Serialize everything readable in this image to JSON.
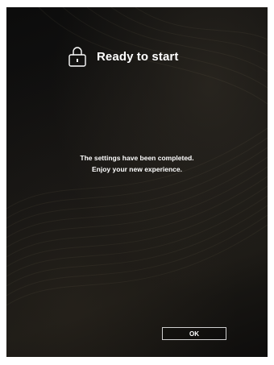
{
  "header": {
    "icon": "lock-icon",
    "title": "Ready to start"
  },
  "message": {
    "line1": "The settings have been completed.",
    "line2": "Enjoy your new experience."
  },
  "actions": {
    "ok_label": "OK"
  },
  "colors": {
    "background": "#121110",
    "text": "#ffffff",
    "button_border": "#cfcfcf"
  }
}
